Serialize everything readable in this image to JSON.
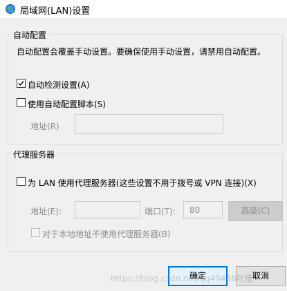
{
  "window": {
    "title": "局域网(LAN)设置"
  },
  "auto_config": {
    "group_title": "自动配置",
    "description": "自动配置会覆盖手动设置。要确保使用手动设置，请禁用自动配置。",
    "auto_detect_label": "自动检测设置(A)",
    "auto_detect_checked": true,
    "use_script_label": "使用自动配置脚本(S)",
    "use_script_checked": false,
    "address_label": "地址(R)",
    "address_value": ""
  },
  "proxy": {
    "group_title": "代理服务器",
    "use_proxy_label": "为 LAN 使用代理服务器(这些设置不用于拨号或 VPN 连接)(X)",
    "use_proxy_checked": false,
    "address_label": "地址(E):",
    "address_value": "",
    "port_label": "端口(T):",
    "port_value": "80",
    "advanced_label": "高级(C)",
    "bypass_local_label": "对于本地地址不使用代理服务器(B)",
    "bypass_local_checked": false
  },
  "buttons": {
    "ok_label": "确定",
    "cancel_label": "取消"
  },
  "watermark": "https://blog.csdn.net/qq49436吐槽"
}
